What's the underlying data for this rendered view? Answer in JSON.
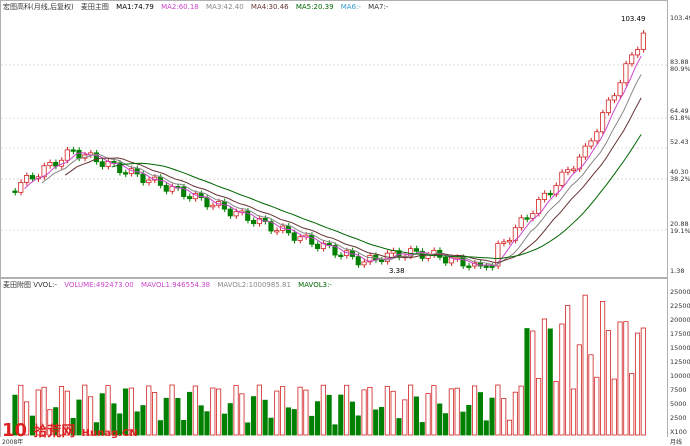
{
  "header": {
    "main_title": "宏图高科(月线,后复权)",
    "indicator_name": "麦田主图",
    "ma1": "MA1:74.79",
    "ma2": "MA2:60.18",
    "ma3": "MA3:42.40",
    "ma4": "MA4:30.46",
    "ma5": "MA5:20.39",
    "ma6": "MA6:-",
    "ma7": "MA7:-"
  },
  "vol_header": {
    "title": "麦田附图 VVOL:-",
    "volume": "VOLUME:492473.00",
    "mavol1": "MAVOL1:946554.38",
    "mavol2": "MAVOL2:1000985.81",
    "mavol3": "MAVOL3:-"
  },
  "price_axis": [
    "103.49",
    "83.88",
    "80.9%",
    "64.49",
    "61.8%",
    "52.43",
    "40.30",
    "38.2%",
    "20.88",
    "19.1%",
    "1.38"
  ],
  "vol_axis": [
    "25000",
    "22500",
    "20000",
    "17500",
    "15000",
    "12500",
    "10000",
    "7500",
    "5000",
    "2500",
    "X100"
  ],
  "annotations": {
    "high": "103.49",
    "low": "3.38"
  },
  "bottom_axis": {
    "start": "2008年",
    "end": "月线"
  },
  "watermark": {
    "brand": "10",
    "site": "拾荒网",
    "url": "Hunag.CN"
  },
  "colors": {
    "up": "#d22222",
    "down": "#008000",
    "ma1": "#000000",
    "ma2": "#cc44cc",
    "ma3": "#888888",
    "ma4": "#663333",
    "ma5": "#006600"
  }
}
